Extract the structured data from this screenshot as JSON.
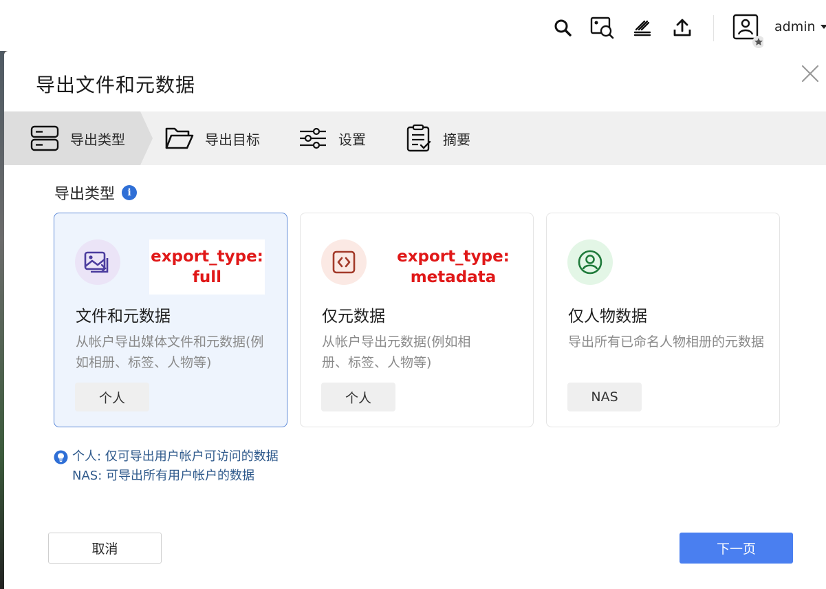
{
  "topbar": {
    "icons": [
      "search-icon",
      "photo-search-icon",
      "stack-icon",
      "upload-icon"
    ],
    "username": "admin"
  },
  "dialog": {
    "title": "导出文件和元数据",
    "steps": [
      {
        "label": "导出类型",
        "icon": "server-icon",
        "active": true
      },
      {
        "label": "导出目标",
        "icon": "folder-open-icon",
        "active": false
      },
      {
        "label": "设置",
        "icon": "sliders-icon",
        "active": false
      },
      {
        "label": "摘要",
        "icon": "clipboard-check-icon",
        "active": false
      }
    ],
    "section_label": "导出类型",
    "cards": [
      {
        "title": "文件和元数据",
        "description": "从帐户导出媒体文件和元数据(例如相册、标签、人物等)",
        "tag": "个人",
        "annotation_line1": "export_type:",
        "annotation_line2": "full",
        "icon": "images-icon",
        "icon_color": "#4b3c9e",
        "circle_color": "#ebe4f7",
        "selected": true
      },
      {
        "title": "仅元数据",
        "description": "从帐户导出元数据(例如相册、标签、人物等)",
        "tag": "个人",
        "annotation_line1": "export_type:",
        "annotation_line2": "metadata",
        "icon": "code-icon",
        "icon_color": "#a33a2a",
        "circle_color": "#fbe9e4",
        "selected": false
      },
      {
        "title": "仅人物数据",
        "description": "导出所有已命名人物相册的元数据",
        "tag": "NAS",
        "icon": "person-circle-icon",
        "icon_color": "#1f7a3a",
        "circle_color": "#e3f6e6",
        "selected": false
      }
    ],
    "notes": [
      "个人: 仅可导出用户帐户可访问的数据",
      "NAS: 可导出所有用户帐户的数据"
    ],
    "cancel_label": "取消",
    "next_label": "下一页"
  },
  "colors": {
    "primary": "#4a7ff0",
    "selected_border": "#5e8ad8",
    "annotation": "#e01818"
  }
}
